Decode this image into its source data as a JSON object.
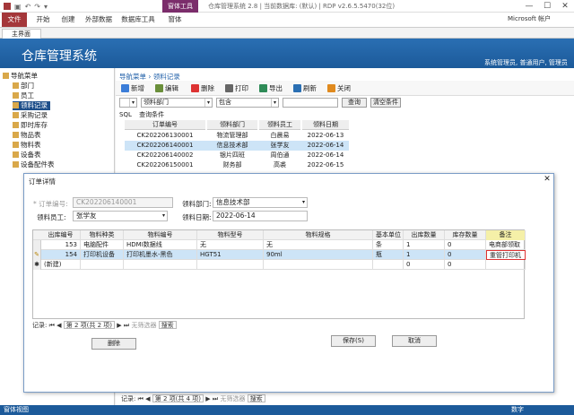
{
  "window": {
    "title": "仓库管理系统 2.8 | 当前数据库: (默认) | RDP v2.6.5.5470(32位)",
    "context_tab": "窗体工具",
    "account": "Microsoft 帐户",
    "controls": [
      "—",
      "☐",
      "✕"
    ]
  },
  "ribbon": {
    "tabs": [
      "文件",
      "开始",
      "创建",
      "外部数据",
      "数据库工具",
      "窗体"
    ]
  },
  "doc_tab": "主界面",
  "banner": {
    "title": "仓库管理系统",
    "user": "系统管理员, 普通用户, 管理员"
  },
  "nav": {
    "root": "导航菜单",
    "items": [
      "部门",
      "员工",
      "领料记录",
      "采购记录",
      "即时库存",
      "物品表",
      "物料表",
      "设备表",
      "设备配件表"
    ],
    "selected_index": 2
  },
  "main": {
    "breadcrumb": "导航菜单 › 领料记录",
    "toolbar": [
      "新增",
      "编辑",
      "删除",
      "打印",
      "导出",
      "刷新",
      "关闭"
    ],
    "filter": {
      "field": "领料部门",
      "op": "包含",
      "value": "",
      "search": "查询",
      "clear": "清空条件"
    },
    "subtabs": [
      "SQL",
      "查询条件"
    ],
    "table": {
      "columns": [
        "订单编号",
        "领料部门",
        "领料员工",
        "领料日期"
      ],
      "rows": [
        [
          "CK202206130001",
          "物流管理部",
          "白晨易",
          "2022-06-13"
        ],
        [
          "CK202206140001",
          "信息技术部",
          "张学友",
          "2022-06-14"
        ],
        [
          "CK202206140002",
          "银片四班",
          "周伯通",
          "2022-06-14"
        ],
        [
          "CK202206150001",
          "财务部",
          "高裘",
          "2022-06-15"
        ]
      ],
      "selected_row": 1
    },
    "recnav": {
      "label": "记录:",
      "pos": "第 2 项(共 4 项)",
      "nofilter": "无筛选器",
      "search": "搜索"
    }
  },
  "dialog": {
    "title": "订单详情",
    "labels": {
      "order_no": "* 订单编号:",
      "dept": "领料部门:",
      "employee": "领料员工:",
      "date": "领料日期:"
    },
    "values": {
      "order_no": "CK202206140001",
      "dept": "信息技术部",
      "employee": "张学友",
      "date": "2022-06-14"
    },
    "grid": {
      "columns": [
        "出库编号",
        "物料种类",
        "物料编号",
        "物料型号",
        "物料规格",
        "基本单位",
        "出库数量",
        "库存数量",
        "备注"
      ],
      "rows": [
        [
          "153",
          "电脑配件",
          "HDMI数据线",
          "无",
          "无",
          "条",
          "1",
          "0",
          "电商部领取"
        ],
        [
          "154",
          "打印机设备",
          "打印机墨水-黑色",
          "HGT51",
          "90ml",
          "瓶",
          "1",
          "0",
          "重管打印机"
        ],
        [
          "(新建)",
          "",
          "",
          "",
          "",
          "",
          "0",
          "0",
          ""
        ]
      ]
    },
    "recnav": {
      "label": "记录:",
      "pos": "第 2 项(共 2 项)",
      "nofilter": "无筛选器",
      "search": "搜索"
    },
    "buttons": {
      "delete": "删除",
      "save": "保存(S)",
      "cancel": "取消"
    }
  },
  "status": {
    "left": "窗体视图",
    "right": "数字"
  }
}
